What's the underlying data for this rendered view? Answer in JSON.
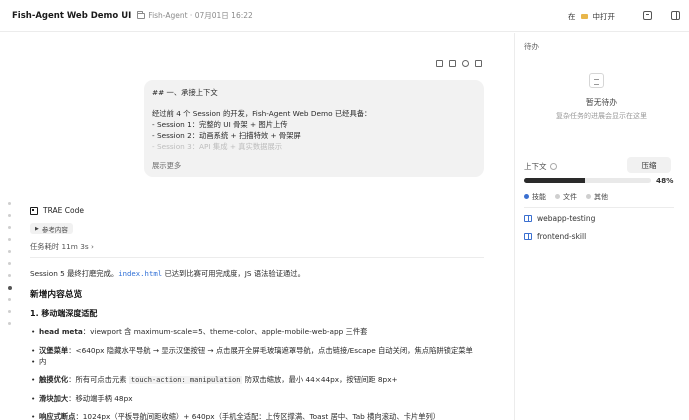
{
  "header": {
    "title": "Fish-Agent Web Demo UI",
    "subtitle": "Fish-Agent · 07月01日 16:22",
    "open_prefix": "在",
    "open_suffix": "中打开"
  },
  "message": {
    "lines": [
      "## 一、承接上下文",
      "",
      "经过前 4 个 Session 的开发，Fish-Agent Web Demo 已经具备：",
      "- Session 1：完整的 UI 骨架 + 图片上传",
      "- Session 2：动画系统 + 扫描特效 + 骨架屏",
      "- Session 3：API 集成 + 真实数据展示"
    ],
    "show_more": "展示更多"
  },
  "assistant": {
    "name": "TRAE Code",
    "ref_chip": "参考内容",
    "task_time": "任务耗时 11m 3s"
  },
  "content": {
    "intro_a": "Session 5 最终打磨完成。",
    "intro_code": "index.html",
    "intro_b": " 已达到比赛可用完成度，JS 语法验证通过。",
    "section_title": "新增内容总览",
    "sub_title": "1. 移动端深度适配",
    "b1_bold": "head meta",
    "b1_text": "：viewport 含 maximum-scale=5、theme-color、apple-mobile-web-app 三件套",
    "b2_bold": "汉堡菜单",
    "b2_text_1": "：<640px 隐藏水平导航 → 显示汉堡按钮 → 点击展开全屏毛玻璃遮罩导航，点击链接/Escape 自动关闭，焦点陷阱锁定菜单",
    "b2_text_2": "内",
    "b3_bold": "触摸优化",
    "b3_text_a": "：所有可点击元素 ",
    "b3_code": "touch-action: manipulation",
    "b3_text_b": " 防双击缩放，最小 44×44px，按钮间距 8px+",
    "b4_bold": "滑块加大",
    "b4_text": "：移动端手柄 48px",
    "b5_bold": "响应式断点",
    "b5_text": "：1024px（平板导航间距收缩）+ 640px（手机全适配：上传区撑满、Toast 居中、Tab 横向滚动、卡片单列）"
  },
  "sidebar": {
    "todo_heading": "待办",
    "empty_title": "暂无待办",
    "empty_desc": "复杂任务的进展会显示在这里",
    "context_label": "上下文",
    "compress_label": "压缩",
    "progress": 0.48,
    "progress_text": "48%",
    "legend": [
      {
        "label": "技能",
        "color": "#3a6fd0"
      },
      {
        "label": "文件",
        "color": "#cfcfcf"
      },
      {
        "label": "其他",
        "color": "#cfcfcf"
      }
    ],
    "skills": [
      "webapp-testing",
      "frontend-skill"
    ]
  }
}
